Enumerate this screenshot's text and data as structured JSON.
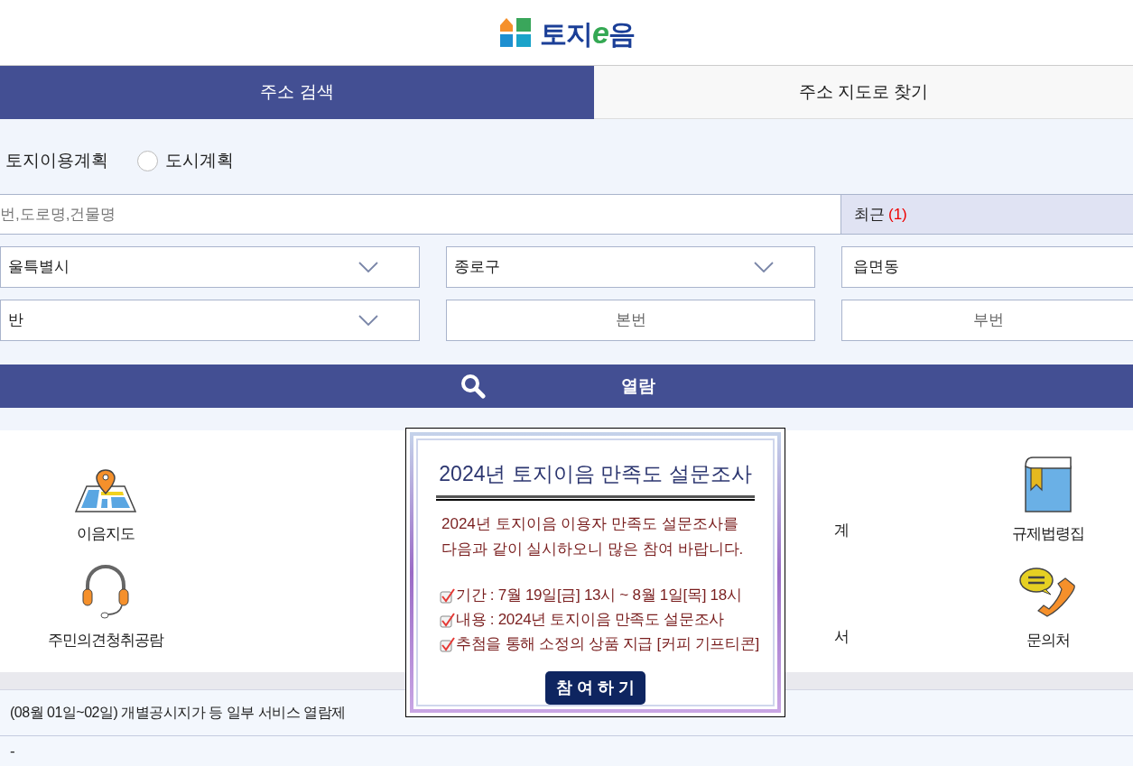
{
  "logo": {
    "parts": [
      "토지",
      "e",
      "음"
    ]
  },
  "tabs": [
    {
      "label": "주소 검색",
      "selected": true
    },
    {
      "label": "주소 지도로 찾기",
      "selected": false
    }
  ],
  "plan_options": [
    {
      "kind": "label",
      "label": "토지이용계획"
    },
    {
      "kind": "radio",
      "label": "도시계획",
      "selected": false
    }
  ],
  "search": {
    "placeholder": "번,도로명,건물명",
    "recent_label": "최근",
    "recent_count": "(1)"
  },
  "address_fields": [
    {
      "kind": "select",
      "value": "울특별시"
    },
    {
      "kind": "select",
      "value": "종로구"
    },
    {
      "kind": "input",
      "value": "읍면동"
    },
    {
      "kind": "select",
      "value": "반"
    },
    {
      "kind": "input",
      "placeholder": "본번"
    },
    {
      "kind": "input",
      "placeholder": "부번"
    }
  ],
  "view_button": "열람",
  "menu_rows": [
    [
      {
        "kind": "map",
        "label": "이음지도"
      },
      {
        "kind": "blank"
      },
      {
        "kind": "fragment",
        "label": "계"
      },
      {
        "kind": "book",
        "label": "규제법령집"
      }
    ],
    [
      {
        "kind": "headset",
        "label": "주민의견청취공람"
      },
      {
        "kind": "blank"
      },
      {
        "kind": "fragment",
        "label": "서"
      },
      {
        "kind": "phone",
        "label": "문의처"
      }
    ]
  ],
  "notice": {
    "title": "(08월 01일~02일) 개별공시지가 등 일부 서비스 열람제",
    "line_2": "-"
  },
  "popup": {
    "title": "2024년 토지이음 만족도 설문조사",
    "intro": [
      "2024년 토지이음 이용자 만족도 설문조사를",
      "다음과 같이 실시하오니 많은 참여 바랍니다."
    ],
    "items": [
      "기간 : 7월 19일[금] 13시 ~ 8월 1일[목] 18시",
      "내용 : 2024년 토지이음 만족도 설문조사",
      "추첨을 통해 소정의 상품 지급 [커피 기프티콘]"
    ],
    "button": "참 여 하 기"
  }
}
